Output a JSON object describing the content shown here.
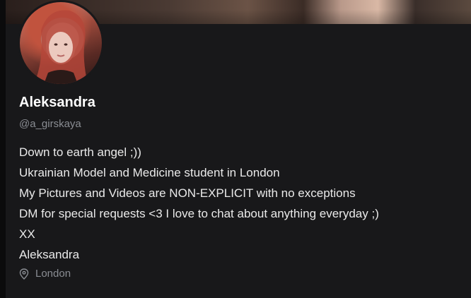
{
  "profile": {
    "name": "Aleksandra",
    "handle": "@a_girskaya",
    "bio": [
      "Down to earth angel ;))",
      "Ukrainian Model and Medicine student in London",
      "My Pictures and Videos are NON-EXPLICIT with no exceptions",
      "DM for special requests <3 I love to chat about anything everyday ;)",
      "XX",
      "Aleksandra"
    ],
    "location": "London",
    "location_icon": "map-pin-icon"
  }
}
